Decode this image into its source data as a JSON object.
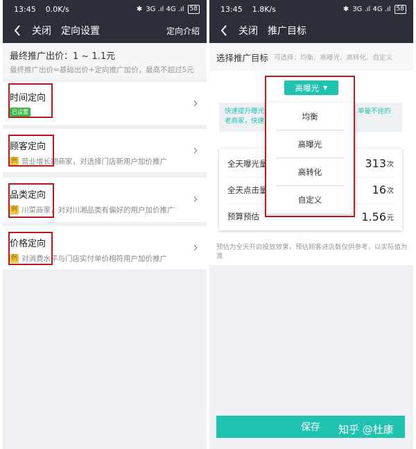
{
  "left": {
    "status": {
      "time": "13:45",
      "speed": "0.0K/s",
      "network": "3G .ıl 4G .ıl",
      "battery": "58"
    },
    "nav": {
      "close": "关闭",
      "title": "定向设置",
      "right": "定向介绍"
    },
    "bid": {
      "title": "最终推广出价：1 ~ 1.1元",
      "subtitle": "最终推广出价=基础出价+定向推广加价，最高不超过5元"
    },
    "cards": [
      {
        "title": "时间定向",
        "tag": "已设置"
      },
      {
        "title": "顾客定向",
        "badge": "例",
        "example": "营业增长期商家，对选择门店新用户加价推广"
      },
      {
        "title": "品类定向",
        "badge": "例",
        "example": "川菜商家，对对川湘品类有偏好的用户加价推广"
      },
      {
        "title": "价格定向",
        "badge": "例",
        "example": "对消费水平与门店实付单价相符用户加价推广"
      }
    ]
  },
  "right": {
    "status": {
      "time": "13:45",
      "speed": "1.8K/s",
      "network": "3G .ıl 4G .ıl",
      "battery": "58"
    },
    "nav": {
      "close": "关闭",
      "title": "推广目标"
    },
    "goal": {
      "label": "选择推广目标",
      "hint": "可选择：均衡、高曝光、高转化、自定义"
    },
    "dropdown": {
      "selected": "高曝光"
    },
    "tip": {
      "line1": "快速提升曝光量",
      "line2": "老商家，快速",
      "line1b": "单量不佳的"
    },
    "menu": [
      "均衡",
      "高曝光",
      "高转化",
      "自定义"
    ],
    "stats": [
      {
        "label": "全天曝光量",
        "value": "313",
        "unit": "次"
      },
      {
        "label": "全天点击量",
        "value": "16",
        "unit": "次"
      },
      {
        "label": "预算预估",
        "value": "1.56",
        "unit": "元"
      }
    ],
    "note": "预估为全天开启投放效果，预估顾客进店数仅供参考，以实际值为准",
    "save": "保存"
  },
  "watermark": "知乎 @杜康",
  "colors": {
    "nav": "#2b2f3a",
    "accent": "#1fc3b0",
    "highlight": "#b61c1c",
    "tag_green": "#3db54a",
    "badge_yellow": "#f3c84a"
  }
}
